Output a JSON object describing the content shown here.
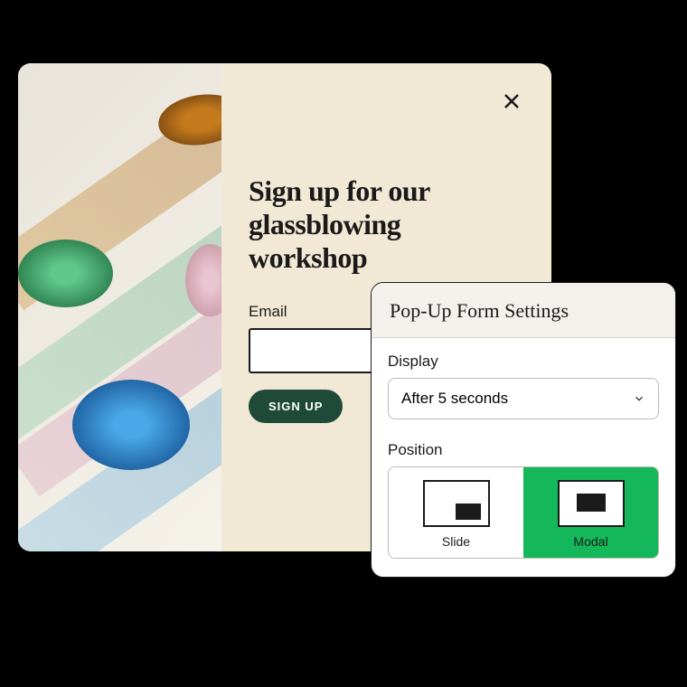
{
  "popup": {
    "title": "Sign up for our glassblowing workshop",
    "email_label": "Email",
    "email_value": "",
    "signup_button": "SIGN UP"
  },
  "settings": {
    "title": "Pop-Up Form Settings",
    "display_label": "Display",
    "display_value": "After 5 seconds",
    "position_label": "Position",
    "positions": [
      {
        "label": "Slide",
        "selected": false
      },
      {
        "label": "Modal",
        "selected": true
      }
    ]
  }
}
